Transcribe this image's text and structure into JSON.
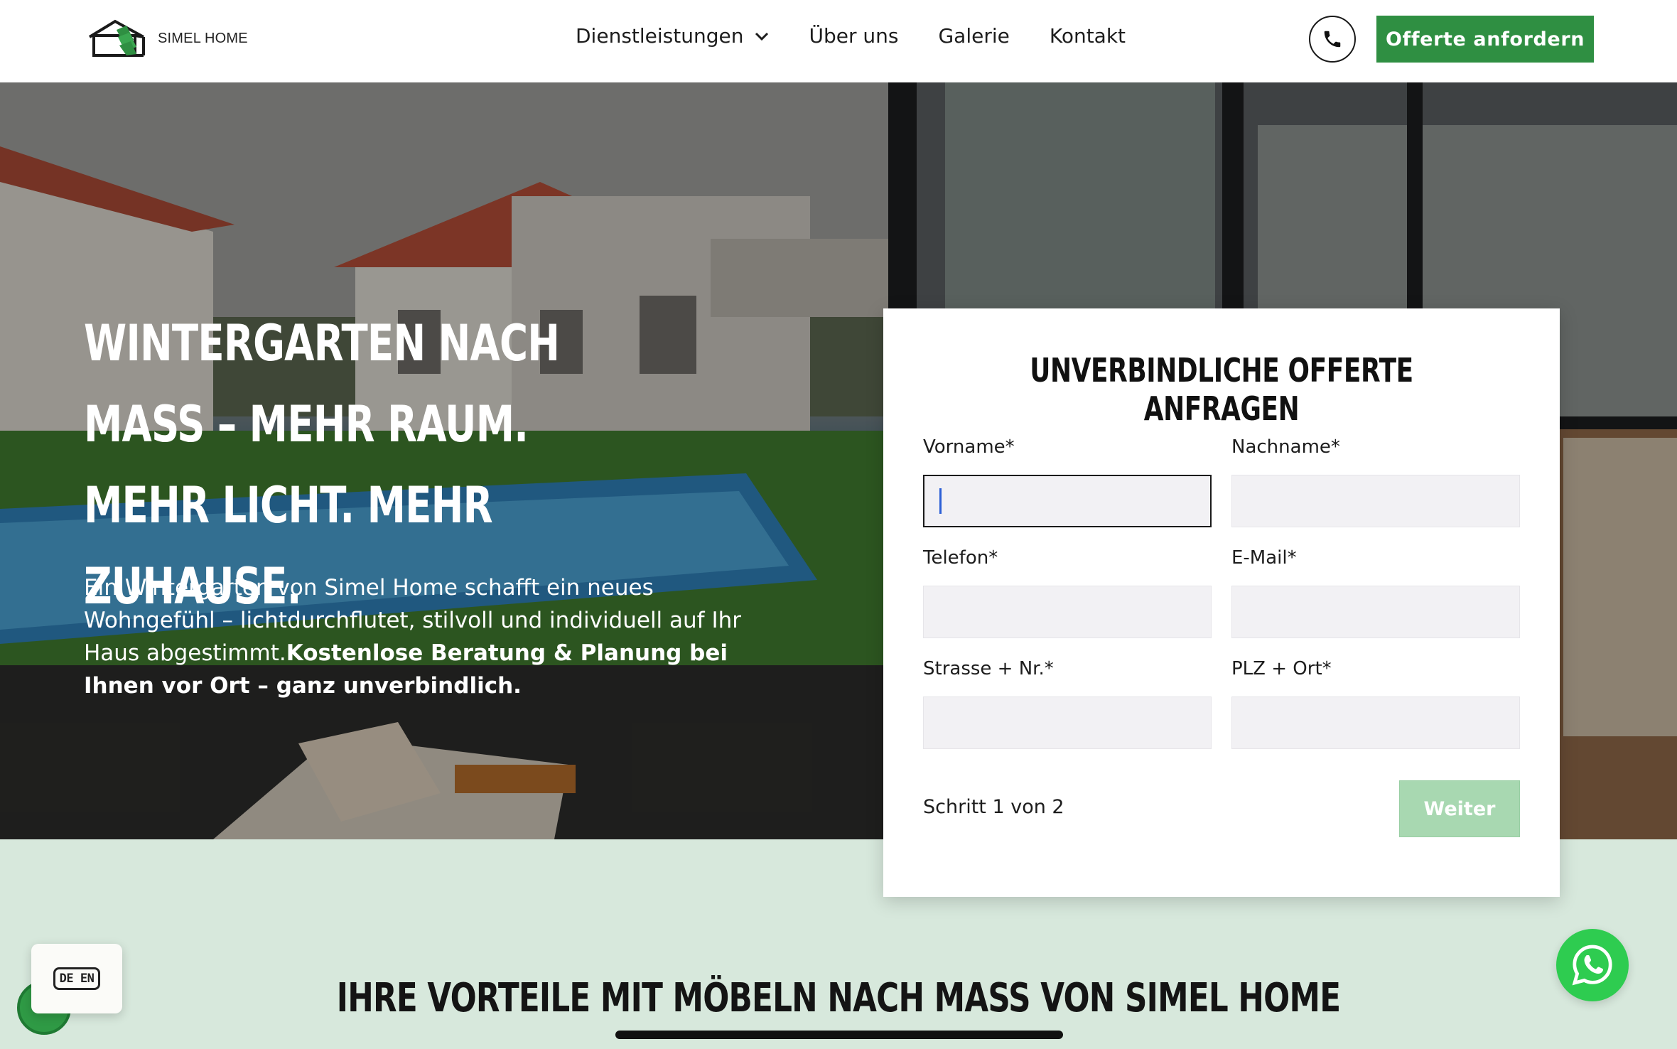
{
  "brand": {
    "name": "SIMEL HOME",
    "accent": "#2f8f42"
  },
  "nav": {
    "items": [
      {
        "label": "Dienstleistungen",
        "has_dropdown": true
      },
      {
        "label": "Über uns"
      },
      {
        "label": "Galerie"
      },
      {
        "label": "Kontakt"
      }
    ]
  },
  "header": {
    "cta_label": "Offerte anfordern",
    "phone_icon": "phone-icon"
  },
  "hero": {
    "title": "Wintergarten nach Mass – mehr Raum. mehr Licht. mehr Zuhause.",
    "text_regular": "Ein Wintergarten von Simel Home schafft ein neues Wohngefühl – lichtdurchflutet, stilvoll und individuell auf Ihr Haus abgestimmt.",
    "text_bold": "Kostenlose Beratung & Planung bei Ihnen vor Ort – ganz unverbindlich."
  },
  "form": {
    "title": "Unverbindliche Offerte anfragen",
    "fields": {
      "vorname": {
        "label": "Vorname*",
        "value": ""
      },
      "nachname": {
        "label": "Nachname*",
        "value": ""
      },
      "telefon": {
        "label": "Telefon*",
        "value": ""
      },
      "email": {
        "label": "E-Mail*",
        "value": ""
      },
      "strasse": {
        "label": "Strasse + Nr.*",
        "value": ""
      },
      "plz": {
        "label": "PLZ + Ort*",
        "value": ""
      }
    },
    "step_text": "Schritt 1 von 2",
    "next_label": "Weiter"
  },
  "section": {
    "title": "Ihre Vorteile mit Möbeln nach Mass von Simel Home"
  },
  "language_widget": {
    "label": "DE EN"
  },
  "floating": {
    "whatsapp_icon": "whatsapp-icon"
  }
}
